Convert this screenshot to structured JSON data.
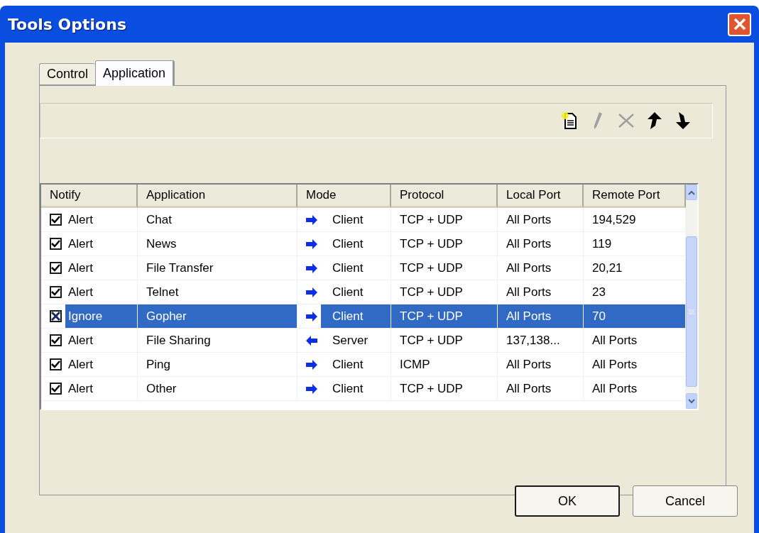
{
  "window": {
    "title": "Tools Options"
  },
  "tabs": [
    {
      "label": "Control",
      "selected": false
    },
    {
      "label": "Application",
      "selected": true
    }
  ],
  "toolbar": [
    {
      "kind": "new",
      "disabled": false
    },
    {
      "kind": "edit",
      "disabled": true
    },
    {
      "kind": "delete",
      "disabled": true
    },
    {
      "kind": "up",
      "disabled": false
    },
    {
      "kind": "down",
      "disabled": false
    }
  ],
  "table": {
    "columns": [
      "Notify",
      "Application",
      "Mode",
      "Protocol",
      "Local Port",
      "Remote Port"
    ],
    "rows": [
      {
        "notify": "Alert",
        "kind": "alert",
        "application": "Chat",
        "inbound": false,
        "mode": "Client",
        "protocol": "TCP + UDP",
        "local_port": "All Ports",
        "remote_port": "194,529",
        "selected": false
      },
      {
        "notify": "Alert",
        "kind": "alert",
        "application": "News",
        "inbound": false,
        "mode": "Client",
        "protocol": "TCP + UDP",
        "local_port": "All Ports",
        "remote_port": "119",
        "selected": false
      },
      {
        "notify": "Alert",
        "kind": "alert",
        "application": "File Transfer",
        "inbound": false,
        "mode": "Client",
        "protocol": "TCP + UDP",
        "local_port": "All Ports",
        "remote_port": "20,21",
        "selected": false
      },
      {
        "notify": "Alert",
        "kind": "alert",
        "application": "Telnet",
        "inbound": false,
        "mode": "Client",
        "protocol": "TCP + UDP",
        "local_port": "All Ports",
        "remote_port": "23",
        "selected": false
      },
      {
        "notify": "Ignore",
        "kind": "ignore",
        "application": "Gopher",
        "inbound": false,
        "mode": "Client",
        "protocol": "TCP + UDP",
        "local_port": "All Ports",
        "remote_port": "70",
        "selected": true
      },
      {
        "notify": "Alert",
        "kind": "alert",
        "application": "File Sharing",
        "inbound": true,
        "mode": "Server",
        "protocol": "TCP + UDP",
        "local_port": "137,138...",
        "remote_port": "All Ports",
        "selected": false
      },
      {
        "notify": "Alert",
        "kind": "alert",
        "application": "Ping",
        "inbound": false,
        "mode": "Client",
        "protocol": "ICMP",
        "local_port": "All Ports",
        "remote_port": "All Ports",
        "selected": false
      },
      {
        "notify": "Alert",
        "kind": "alert",
        "application": "Other",
        "inbound": false,
        "mode": "Client",
        "protocol": "TCP + UDP",
        "local_port": "All Ports",
        "remote_port": "All Ports",
        "selected": false
      }
    ]
  },
  "buttons": [
    "OK",
    "Cancel"
  ]
}
